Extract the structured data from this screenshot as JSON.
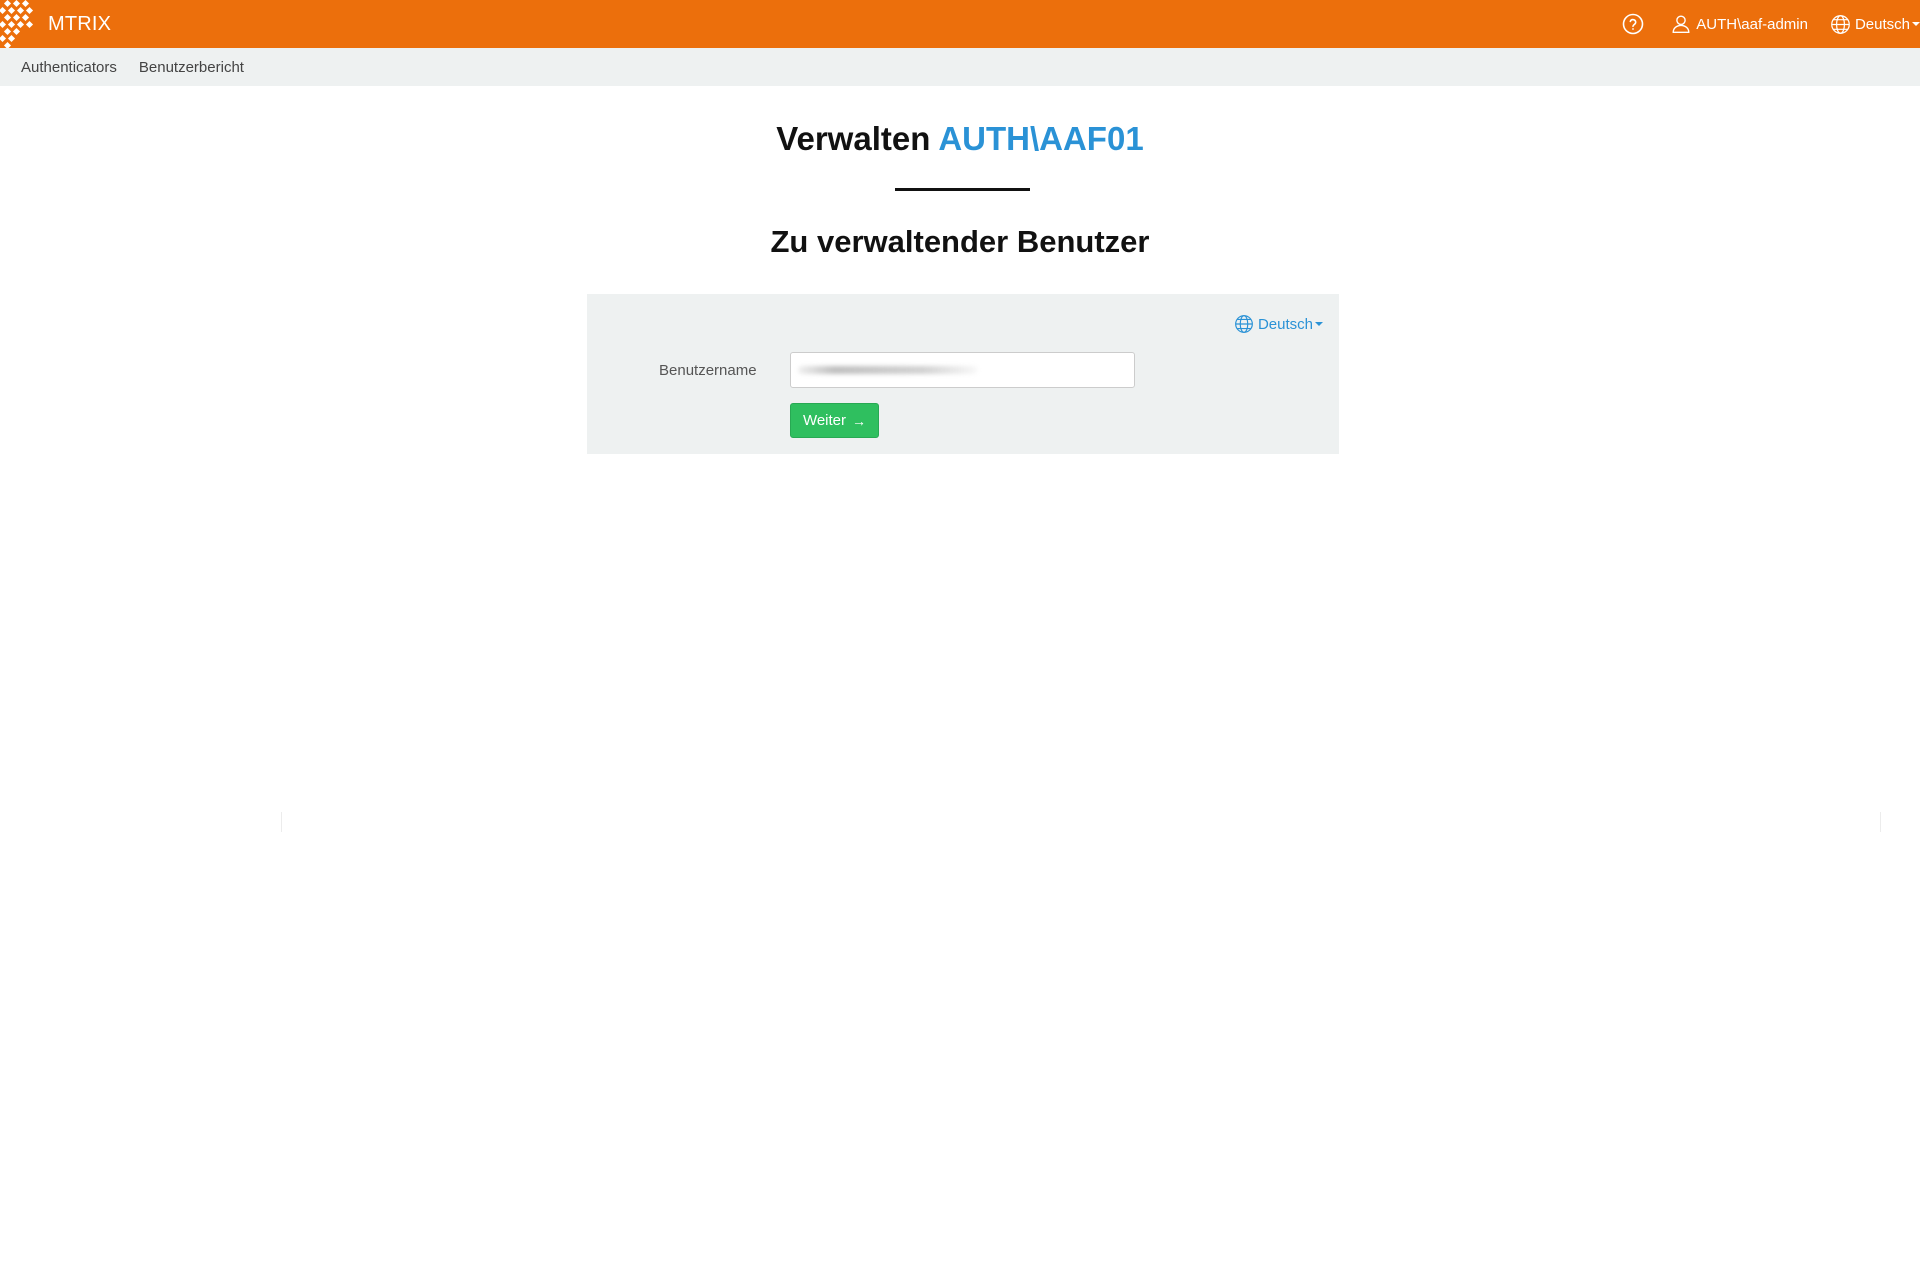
{
  "header": {
    "brand": "MTRIX",
    "user": "AUTH\\aaf-admin",
    "language": "Deutsch",
    "icons": {
      "help": "help-circle-icon",
      "user": "user-icon",
      "language": "globe-icon"
    }
  },
  "subnav": {
    "items": [
      {
        "label": "Authenticators"
      },
      {
        "label": "Benutzerbericht"
      }
    ]
  },
  "main": {
    "title_prefix": "Verwalten",
    "title_target": "AUTH\\AAF01",
    "subtitle": "Zu verwaltender Benutzer",
    "panel": {
      "language": "Deutsch",
      "username_label": "Benutzername",
      "username_value": "",
      "next_button": "Weiter",
      "next_icon": "arrow-right-icon"
    }
  },
  "colors": {
    "header_bg": "#ec6f0c",
    "accent": "#2a92d6",
    "button": "#2fbf5f",
    "panel_bg": "#eef1f1"
  }
}
